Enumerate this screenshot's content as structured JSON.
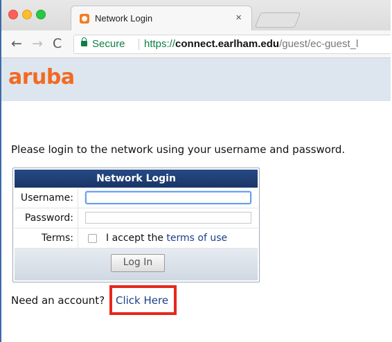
{
  "browser": {
    "tab_title": "Network Login",
    "tab_close": "×",
    "nav": {
      "back": "←",
      "forward": "→",
      "reload": "C"
    },
    "secure_label": "Secure",
    "url": {
      "scheme": "https://",
      "host": "connect.earlham.edu",
      "path": "/guest/ec-guest_l"
    }
  },
  "page": {
    "logo": "aruba",
    "intro": "Please login to the network using your username and password.",
    "login": {
      "title": "Network Login",
      "username_label": "Username:",
      "username_value": "",
      "password_label": "Password:",
      "password_value": "",
      "terms_label": "Terms:",
      "terms_prefix": "I accept the",
      "terms_link": "terms of use",
      "terms_checked": false,
      "submit": "Log In"
    },
    "need_account": "Need an account?",
    "click_here": "Click Here"
  },
  "colors": {
    "brand_orange": "#f26a21",
    "header_bg": "#dde6ee",
    "panel_title": "#1f3f78",
    "link": "#1a3f88",
    "highlight": "#e8261c"
  }
}
